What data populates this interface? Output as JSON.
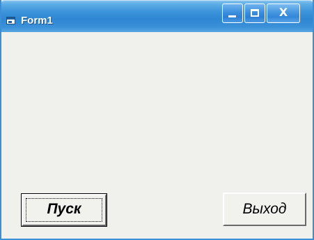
{
  "window": {
    "title": "Form1",
    "icon": "vb-form-icon",
    "controls": {
      "minimize": "minimize-icon",
      "maximize": "maximize-icon",
      "close_glyph": "X"
    }
  },
  "form": {
    "start_button_label": "Пуск",
    "exit_button_label": "Выход"
  },
  "colors": {
    "titlebar": "#2f86d2",
    "client_background": "#f0f0ec"
  }
}
